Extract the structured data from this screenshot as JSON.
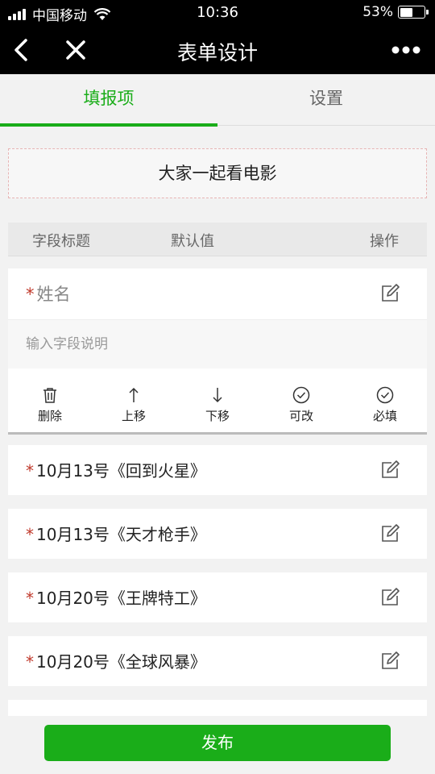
{
  "status": {
    "carrier": "中国移动",
    "time": "10:36",
    "battery": "53%",
    "battery_level": 0.53
  },
  "nav": {
    "title": "表单设计"
  },
  "tabs": [
    {
      "label": "填报项"
    },
    {
      "label": "设置"
    }
  ],
  "form": {
    "title": "大家一起看电影"
  },
  "table_header": {
    "field_title": "字段标题",
    "default_value": "默认值",
    "operation": "操作"
  },
  "editing_field": {
    "required_mark": "*",
    "label": "姓名",
    "description_placeholder": "输入字段说明",
    "actions": [
      {
        "label": "删除"
      },
      {
        "label": "上移"
      },
      {
        "label": "下移"
      },
      {
        "label": "可改"
      },
      {
        "label": "必填"
      }
    ]
  },
  "fields": [
    {
      "required_mark": "*",
      "label": "10月13号《回到火星》"
    },
    {
      "required_mark": "*",
      "label": "10月13号《天才枪手》"
    },
    {
      "required_mark": "*",
      "label": "10月20号《王牌特工》"
    },
    {
      "required_mark": "*",
      "label": "10月20号《全球风暴》"
    }
  ],
  "publish_label": "发布"
}
